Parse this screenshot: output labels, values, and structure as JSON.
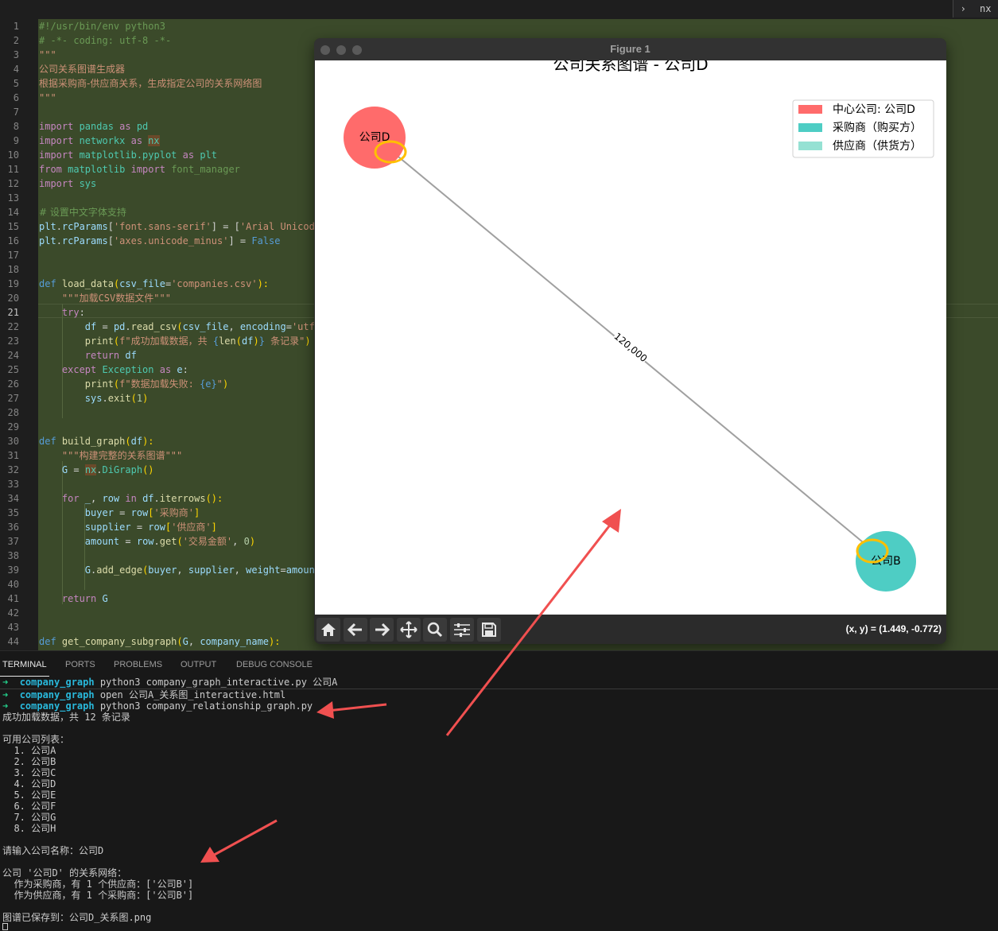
{
  "top_tab": {
    "chevron": "›",
    "label": "nx"
  },
  "editor": {
    "line_numbers": [
      "1",
      "2",
      "3",
      "4",
      "5",
      "6",
      "7",
      "8",
      "9",
      "10",
      "11",
      "12",
      "13",
      "14",
      "15",
      "16",
      "17",
      "18",
      "19",
      "20",
      "21",
      "22",
      "23",
      "24",
      "25",
      "26",
      "27",
      "28",
      "29",
      "30",
      "31",
      "32",
      "33",
      "34",
      "35",
      "36",
      "37",
      "38",
      "39",
      "40",
      "41",
      "42",
      "43",
      "44"
    ],
    "active_line": "21",
    "code": {
      "l1": "#!/usr/bin/env python3",
      "l2": "# -*- coding: utf-8 -*-",
      "l3": "\"\"\"",
      "l4": "公司关系图谱生成器",
      "l5": "根据采购商-供应商关系，生成指定公司的关系网络图",
      "l6": "\"\"\"",
      "l8a": "import",
      "l8b": " pandas ",
      "l8c": "as",
      "l8d": " pd",
      "l9a": "import",
      "l9b": " networkx ",
      "l9c": "as",
      "l9d": "nx",
      "l10a": "import",
      "l10b": " matplotlib.pyplot ",
      "l10c": "as",
      "l10d": " plt",
      "l11a": "from",
      "l11b": " matplotlib ",
      "l11c": "import",
      "l11d": " font_manager",
      "l12a": "import",
      "l12b": " sys",
      "l14": "# 设置中文字体支持",
      "l15a": "plt",
      "l15b": ".",
      "l15c": "rcParams",
      "l15d": "[",
      "l15e": "'font.sans-serif'",
      "l15f": "] = [",
      "l15g": "'Arial Unicod",
      "l16a": "plt",
      "l16b": ".",
      "l16c": "rcParams",
      "l16d": "[",
      "l16e": "'axes.unicode_minus'",
      "l16f": "] = ",
      "l16g": "False",
      "l19a": "def",
      "l19b": " load_data",
      "l19c": "(",
      "l19d": "csv_file",
      "l19e": "=",
      "l19f": "'companies.csv'",
      "l19g": "):",
      "l20": "    \"\"\"加载CSV数据文件\"\"\"",
      "l21a": "    try",
      "l21b": ":",
      "l22a": "        df",
      "l22b": " = ",
      "l22c": "pd",
      "l22d": ".",
      "l22e": "read_csv",
      "l22f": "(",
      "l22g": "csv_file",
      "l22h": ", ",
      "l22i": "encoding",
      "l22j": "=",
      "l22k": "'utf",
      "l23a": "        print",
      "l23b": "(",
      "l23c": "f\"成功加载数据，共 ",
      "l23d": "{",
      "l23e": "len",
      "l23f": "(",
      "l23g": "df",
      "l23h": ")",
      "l23i": "}",
      "l23j": " 条记录\"",
      "l23k": ")",
      "l24a": "        return",
      "l24b": " df",
      "l25a": "    except",
      "l25b": " Exception",
      "l25c": " as",
      "l25d": " e",
      "l25e": ":",
      "l26a": "        print",
      "l26b": "(",
      "l26c": "f\"数据加载失败: ",
      "l26d": "{e}",
      "l26e": "\"",
      "l26f": ")",
      "l27a": "        sys",
      "l27b": ".",
      "l27c": "exit",
      "l27d": "(",
      "l27e": "1",
      "l27f": ")",
      "l30a": "def",
      "l30b": " build_graph",
      "l30c": "(",
      "l30d": "df",
      "l30e": "):",
      "l31": "    \"\"\"构建完整的关系图谱\"\"\"",
      "l32a": "    G",
      "l32b": " = ",
      "l32c": "nx",
      "l32d": ".",
      "l32e": "DiGraph",
      "l32f": "()",
      "l34a": "    for",
      "l34b": " _",
      "l34c": ", ",
      "l34d": "row",
      "l34e": " in ",
      "l34f": "df",
      "l34g": ".",
      "l34h": "iterrows",
      "l34i": "():",
      "l35a": "        buyer",
      "l35b": " = ",
      "l35c": "row",
      "l35d": "[",
      "l35e": "'采购商'",
      "l35f": "]",
      "l36a": "        supplier",
      "l36b": " = ",
      "l36c": "row",
      "l36d": "[",
      "l36e": "'供应商'",
      "l36f": "]",
      "l37a": "        amount",
      "l37b": " = ",
      "l37c": "row",
      "l37d": ".",
      "l37e": "get",
      "l37f": "(",
      "l37g": "'交易金额'",
      "l37h": ", ",
      "l37i": "0",
      "l37j": ")",
      "l39a": "        G",
      "l39b": ".",
      "l39c": "add_edge",
      "l39d": "(",
      "l39e": "buyer",
      "l39f": ", ",
      "l39g": "supplier",
      "l39h": ", ",
      "l39i": "weight",
      "l39j": "=",
      "l39k": "amoun",
      "l41a": "    return",
      "l41b": " G",
      "l44a": "def",
      "l44b": " get_company_subgraph",
      "l44c": "(",
      "l44d": "G",
      "l44e": ", ",
      "l44f": "company_name",
      "l44g": "):"
    }
  },
  "figure": {
    "window_title": "Figure 1",
    "coord_readout": "(x, y) = (1.449, -0.772)",
    "toolbar": [
      "home-icon",
      "back-arrow-icon",
      "forward-arrow-icon",
      "pan-icon",
      "zoom-icon",
      "configure-subplots-icon",
      "save-icon"
    ],
    "plot": {
      "title": "公司关系图谱 - 公司D",
      "nodes": [
        {
          "label": "公司D",
          "role": "center",
          "color": "#ff6b6b"
        },
        {
          "label": "公司B",
          "role": "buyer",
          "color": "#4ecdc4"
        }
      ],
      "edge_label": "120,000",
      "edge_color": "#a0a0a0",
      "highlight_color": "#ffbf00",
      "legend": [
        {
          "label": "中心公司: 公司D",
          "color": "#ff6b6b"
        },
        {
          "label": "采购商（购买方）",
          "color": "#4ecdc4"
        },
        {
          "label": "供应商（供货方）",
          "color": "#95e1d3"
        }
      ]
    }
  },
  "panel": {
    "tabs": [
      "TERMINAL",
      "PORTS",
      "PROBLEMS",
      "OUTPUT",
      "DEBUG CONSOLE"
    ],
    "active_tab": "TERMINAL",
    "prompt_arrow": "➜",
    "prompt_dir": "company_graph",
    "commands": [
      "python3 company_graph_interactive.py 公司A",
      "open 公司A_关系图_interactive.html",
      "python3 company_relationship_graph.py"
    ],
    "output": {
      "loaded": "成功加载数据，共 12 条记录",
      "list_title": "可用公司列表：",
      "companies": [
        "  1. 公司A",
        "  2. 公司B",
        "  3. 公司C",
        "  4. 公司D",
        "  5. 公司E",
        "  6. 公司F",
        "  7. 公司G",
        "  8. 公司H"
      ],
      "prompt_input": "请输入公司名称：公司D",
      "network_title": "公司 '公司D' 的关系网络：",
      "as_buyer": "  作为采购商，有 1 个供应商：['公司B']",
      "as_supplier": "  作为供应商，有 1 个采购商：['公司B']",
      "saved": "图谱已保存到：公司D_关系图.png"
    }
  },
  "annotations": {
    "arrow_color": "#f05050"
  }
}
